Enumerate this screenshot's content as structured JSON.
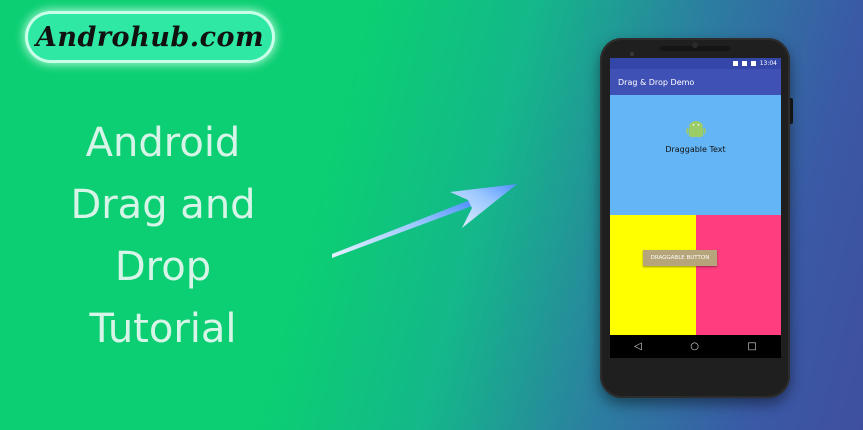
{
  "logo": {
    "text": "Androhub.com"
  },
  "headline": {
    "lines": [
      "Android",
      "Drag and",
      "Drop",
      "Tutorial"
    ]
  },
  "phone": {
    "status_time": "13:04",
    "app_title": "Drag & Drop Demo",
    "draggable_text": "Draggable Text",
    "draggable_button": "DRAGGABLE BUTTON",
    "nav": {
      "back": "◁",
      "home": "○",
      "recents": "□"
    },
    "icons": [
      "android-robot-icon",
      "wifi-icon",
      "signal-icon",
      "battery-icon"
    ]
  },
  "colors": {
    "background_start": "#0bcf72",
    "background_end": "#3f4f9f",
    "app_bar": "#3f51b5",
    "top_pane": "#64b5f6",
    "left_pane": "#ffff00",
    "right_pane": "#ff3d7f"
  }
}
